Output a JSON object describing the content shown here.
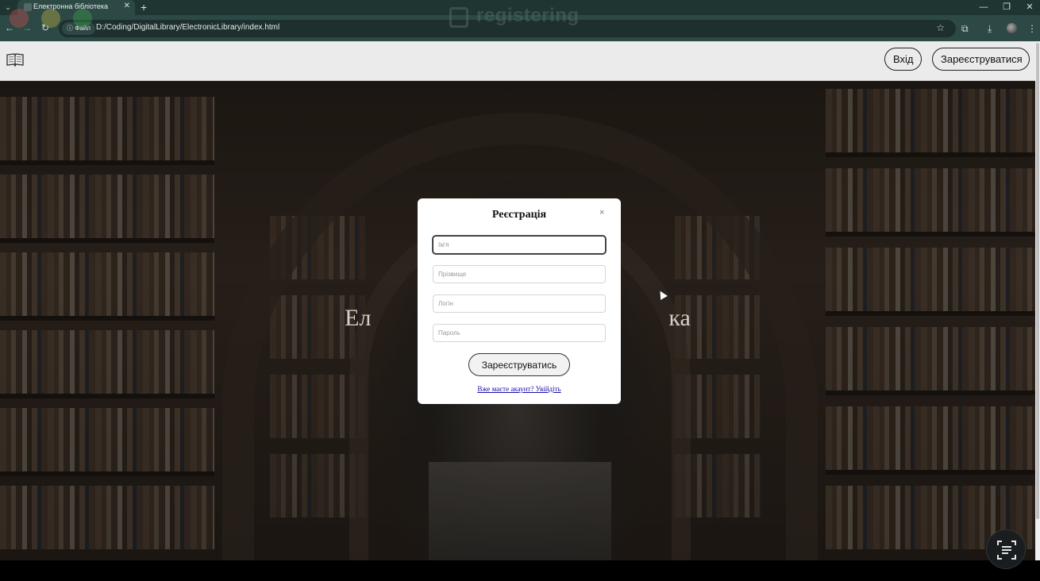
{
  "browser": {
    "tab_title": "Електронна бібліотека",
    "new_tab_icon": "+",
    "site_info_label": "ⓘ Файл",
    "url": "D:/Coding/DigitalLibrary/ElectronicLibrary/index.html",
    "window_controls": {
      "minimize": "—",
      "restore": "❐",
      "close": "✕"
    }
  },
  "watermark": {
    "title": "registering"
  },
  "header": {
    "login_label": "Вхід",
    "register_label": "Зареєструватися"
  },
  "hero": {
    "title": "Ел                                                  ка"
  },
  "modal": {
    "title": "Реєстрація",
    "close_label": "×",
    "fields": {
      "name_placeholder": "Ім'я",
      "surname_placeholder": "Прізвище",
      "login_placeholder": "Логін",
      "password_placeholder": "Пароль"
    },
    "submit_label": "Зареєструватись",
    "login_link": "Вже маєте акаунт? Увійдіть"
  },
  "colors": {
    "chrome_dark": "#1f3532",
    "chrome_bar": "#2d4945",
    "header_bg": "#ebebeb",
    "link": "#1a0dab"
  }
}
